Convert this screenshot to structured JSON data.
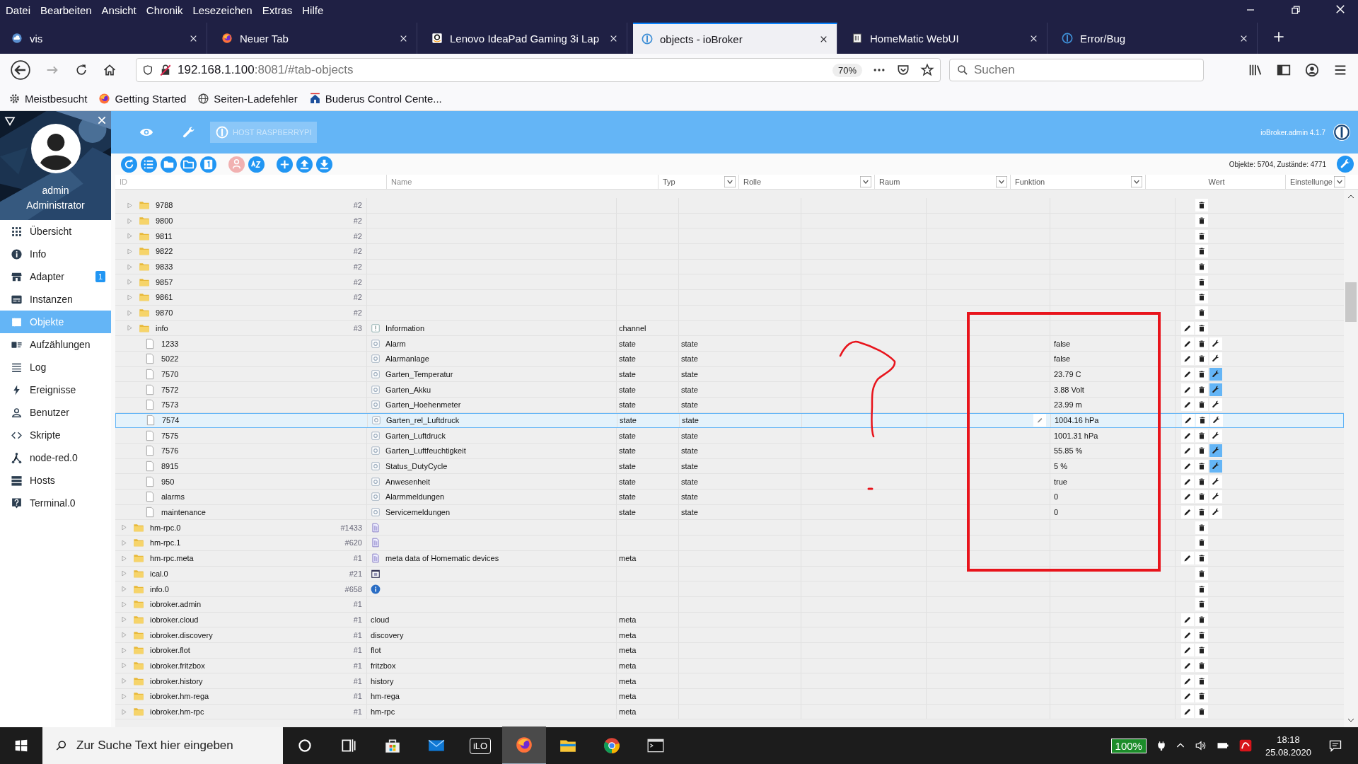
{
  "menu_bar": [
    "Datei",
    "Bearbeiten",
    "Ansicht",
    "Chronik",
    "Lesezeichen",
    "Extras",
    "Hilfe"
  ],
  "tabs": [
    {
      "title": "vis",
      "selected": false
    },
    {
      "title": "Neuer Tab",
      "selected": false
    },
    {
      "title": "Lenovo IdeaPad Gaming 3i Lap",
      "selected": false
    },
    {
      "title": "objects - ioBroker",
      "selected": true
    },
    {
      "title": "HomeMatic WebUI",
      "selected": false
    },
    {
      "title": "Error/Bug",
      "selected": false
    }
  ],
  "address_bar": {
    "host": "192.168.1.100",
    "path": ":8081/#tab-objects",
    "zoom": "70%"
  },
  "search": {
    "placeholder": "Suchen"
  },
  "bookmarks": [
    "Meistbesucht",
    "Getting Started",
    "Seiten-Ladefehler",
    "Buderus Control Cente..."
  ],
  "user": {
    "name": "admin",
    "role": "Administrator"
  },
  "sidebar": {
    "items": [
      {
        "label": "Übersicht",
        "selected": false
      },
      {
        "label": "Info",
        "selected": false
      },
      {
        "label": "Adapter",
        "selected": false,
        "badge": "1"
      },
      {
        "label": "Instanzen",
        "selected": false
      },
      {
        "label": "Objekte",
        "selected": true
      },
      {
        "label": "Aufzählungen",
        "selected": false
      },
      {
        "label": "Log",
        "selected": false
      },
      {
        "label": "Ereignisse",
        "selected": false
      },
      {
        "label": "Benutzer",
        "selected": false
      },
      {
        "label": "Skripte",
        "selected": false
      },
      {
        "label": "node-red.0",
        "selected": false
      },
      {
        "label": "Hosts",
        "selected": false
      },
      {
        "label": "Terminal.0",
        "selected": false
      }
    ]
  },
  "header": {
    "host_button": "HOST RASPBERRYPI",
    "version": "ioBroker.admin 4.1.7"
  },
  "toolbar": {
    "stats": "Objekte: 5704, Zustände: 4771",
    "buttons": [
      {
        "disabled": false
      },
      {
        "disabled": false
      },
      {
        "disabled": false
      },
      {
        "disabled": false
      },
      {
        "disabled": false
      },
      {
        "disabled": true
      },
      {
        "disabled": false
      },
      {
        "disabled": false
      },
      {
        "disabled": false
      },
      {
        "disabled": false
      }
    ]
  },
  "table": {
    "columns": [
      {
        "label": "ID",
        "filter": false
      },
      {
        "label": "Name",
        "filter": false
      },
      {
        "label": "Typ",
        "filter": true
      },
      {
        "label": "Rolle",
        "filter": true
      },
      {
        "label": "Raum",
        "filter": true
      },
      {
        "label": "Funktion",
        "filter": true
      },
      {
        "label": "Wert",
        "filter": false
      },
      {
        "label": "Einstellunge",
        "filter": true
      }
    ],
    "continued_rows": [
      {
        "kind": "folder",
        "id": "9788",
        "count": "#2",
        "edit": false,
        "settings": false,
        "selected": false
      },
      {
        "kind": "folder",
        "id": "9800",
        "count": "#2",
        "edit": false,
        "settings": false,
        "selected": false
      },
      {
        "kind": "folder",
        "id": "9811",
        "count": "#2",
        "edit": false,
        "settings": false,
        "selected": false
      },
      {
        "kind": "folder",
        "id": "9822",
        "count": "#2",
        "edit": false,
        "settings": false,
        "selected": false
      },
      {
        "kind": "folder",
        "id": "9833",
        "count": "#2",
        "edit": false,
        "settings": false,
        "selected": false
      },
      {
        "kind": "folder",
        "id": "9857",
        "count": "#2",
        "edit": false,
        "settings": false,
        "selected": false
      },
      {
        "kind": "folder",
        "id": "9861",
        "count": "#2",
        "edit": false,
        "settings": false,
        "selected": false
      },
      {
        "kind": "folder",
        "id": "9870",
        "count": "#2",
        "edit": false,
        "settings": false,
        "selected": false
      },
      {
        "kind": "channel",
        "id": "info",
        "count": "#3",
        "name": "Information",
        "type": "channel",
        "edit": true,
        "settings": false,
        "selected": false,
        "children": [
          {
            "kind": "state",
            "id": "1233",
            "name": "Alarm",
            "type": "state",
            "role": "state",
            "value": "false",
            "edit": true,
            "settings": true,
            "settings_active": false,
            "selected": false
          },
          {
            "kind": "state",
            "id": "5022",
            "name": "Alarmanlage",
            "type": "state",
            "role": "state",
            "value": "false",
            "edit": true,
            "settings": true,
            "settings_active": false,
            "selected": false
          },
          {
            "kind": "state",
            "id": "7570",
            "name": "Garten_Temperatur",
            "type": "state",
            "role": "state",
            "value": "23.79 C",
            "edit": true,
            "settings": true,
            "settings_active": true,
            "selected": false
          },
          {
            "kind": "state",
            "id": "7572",
            "name": "Garten_Akku",
            "type": "state",
            "role": "state",
            "value": "3.88 Volt",
            "edit": true,
            "settings": true,
            "settings_active": true,
            "selected": false
          },
          {
            "kind": "state",
            "id": "7573",
            "name": "Garten_Hoehenmeter",
            "type": "state",
            "role": "state",
            "value": "23.99 m",
            "edit": true,
            "settings": true,
            "settings_active": false,
            "selected": false
          },
          {
            "kind": "state",
            "id": "7574",
            "name": "Garten_rel_Luftdruck",
            "type": "state",
            "role": "state",
            "value": "1004.16 hPa",
            "edit": true,
            "settings": true,
            "settings_active": false,
            "selected": true
          },
          {
            "kind": "state",
            "id": "7575",
            "name": "Garten_Luftdruck",
            "type": "state",
            "role": "state",
            "value": "1001.31 hPa",
            "edit": true,
            "settings": true,
            "settings_active": false,
            "selected": false
          },
          {
            "kind": "state",
            "id": "7576",
            "name": "Garten_Luftfeuchtigkeit",
            "type": "state",
            "role": "state",
            "value": "55.85 %",
            "edit": true,
            "settings": true,
            "settings_active": true,
            "selected": false
          },
          {
            "kind": "state",
            "id": "8915",
            "name": "Status_DutyCycle",
            "type": "state",
            "role": "state",
            "value": "5 %",
            "edit": true,
            "settings": true,
            "settings_active": true,
            "selected": false
          },
          {
            "kind": "state",
            "id": "950",
            "name": "Anwesenheit",
            "type": "state",
            "role": "state",
            "value": "true",
            "edit": true,
            "settings": true,
            "settings_active": false,
            "selected": false
          },
          {
            "kind": "state",
            "id": "alarms",
            "name": "Alarmmeldungen",
            "type": "state",
            "role": "state",
            "value": "0",
            "edit": true,
            "settings": true,
            "settings_active": false,
            "selected": false
          },
          {
            "kind": "state",
            "id": "maintenance",
            "name": "Servicemeldungen",
            "type": "state",
            "role": "state",
            "value": "0",
            "edit": true,
            "settings": true,
            "settings_active": false,
            "selected": false
          }
        ]
      }
    ],
    "rows": [
      {
        "kind": "adapter",
        "id": "hm-rpc.0",
        "count": "#1433",
        "edit": false,
        "settings": false,
        "selected": false
      },
      {
        "kind": "adapter",
        "id": "hm-rpc.1",
        "count": "#620",
        "edit": false,
        "settings": false,
        "selected": false
      },
      {
        "kind": "adapter",
        "id": "hm-rpc.meta",
        "count": "#1",
        "name": "meta data of Homematic devices",
        "type": "meta",
        "edit": true,
        "settings": false,
        "selected": false
      },
      {
        "kind": "calendar",
        "id": "ical.0",
        "count": "#21",
        "edit": false,
        "settings": false,
        "selected": false
      },
      {
        "kind": "info",
        "id": "info.0",
        "count": "#658",
        "edit": false,
        "settings": false,
        "selected": false
      },
      {
        "kind": "folder",
        "id": "iobroker.admin",
        "count": "#1",
        "edit": false,
        "settings": false,
        "selected": false
      },
      {
        "kind": "folder",
        "id": "iobroker.cloud",
        "count": "#1",
        "name": "cloud",
        "type": "meta",
        "edit": true,
        "settings": false,
        "selected": false
      },
      {
        "kind": "folder",
        "id": "iobroker.discovery",
        "count": "#1",
        "name": "discovery",
        "type": "meta",
        "edit": true,
        "settings": false,
        "selected": false
      },
      {
        "kind": "folder",
        "id": "iobroker.flot",
        "count": "#1",
        "name": "flot",
        "type": "meta",
        "edit": true,
        "settings": false,
        "selected": false
      },
      {
        "kind": "folder",
        "id": "iobroker.fritzbox",
        "count": "#1",
        "name": "fritzbox",
        "type": "meta",
        "edit": true,
        "settings": false,
        "selected": false
      },
      {
        "kind": "folder",
        "id": "iobroker.history",
        "count": "#1",
        "name": "history",
        "type": "meta",
        "edit": true,
        "settings": false,
        "selected": false
      },
      {
        "kind": "folder",
        "id": "iobroker.hm-rega",
        "count": "#1",
        "name": "hm-rega",
        "type": "meta",
        "edit": true,
        "settings": false,
        "selected": false
      },
      {
        "kind": "folder",
        "id": "iobroker.hm-rpc",
        "count": "#1",
        "name": "hm-rpc",
        "type": "meta",
        "edit": true,
        "settings": false,
        "selected": false
      }
    ]
  },
  "taskbar": {
    "search_placeholder": "Zur Suche Text hier eingeben",
    "apps": [
      {
        "selected": false
      },
      {
        "selected": false
      },
      {
        "selected": false
      },
      {
        "selected": false
      },
      {
        "label": "iLO",
        "selected": false
      },
      {
        "selected": true
      },
      {
        "selected": false
      },
      {
        "selected": false
      },
      {
        "selected": false
      }
    ],
    "battery": "100%",
    "time": "18:18",
    "date": "25.08.2020"
  }
}
